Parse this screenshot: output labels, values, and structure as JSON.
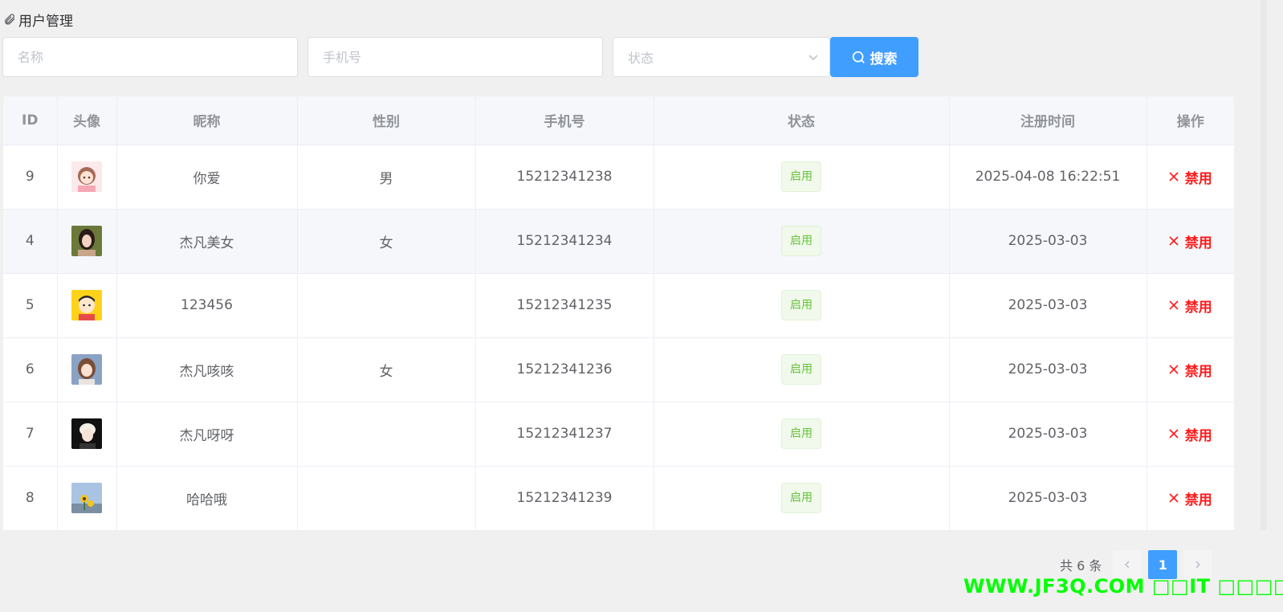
{
  "header": {
    "title": "用户管理",
    "icon": "paperclip-icon"
  },
  "search": {
    "name_placeholder": "名称",
    "phone_placeholder": "手机号",
    "status_placeholder": "状态",
    "button_label": "搜索"
  },
  "table": {
    "columns": [
      "ID",
      "头像",
      "昵称",
      "性别",
      "手机号",
      "状态",
      "注册时间",
      "操作"
    ],
    "rows": [
      {
        "id": "9",
        "avatar": "avatar-anime-girl",
        "nickname": "你爱",
        "gender": "男",
        "phone": "15212341238",
        "status": "启用",
        "registered": "2025-04-08 16:22:51",
        "action": "禁用"
      },
      {
        "id": "4",
        "avatar": "avatar-woman-portrait",
        "nickname": "杰凡美女",
        "gender": "女",
        "phone": "15212341234",
        "status": "启用",
        "registered": "2025-03-03",
        "action": "禁用"
      },
      {
        "id": "5",
        "avatar": "avatar-cartoon-boy",
        "nickname": "123456",
        "gender": "",
        "phone": "15212341235",
        "status": "启用",
        "registered": "2025-03-03",
        "action": "禁用"
      },
      {
        "id": "6",
        "avatar": "avatar-girl-portrait",
        "nickname": "杰凡咳咳",
        "gender": "女",
        "phone": "15212341236",
        "status": "启用",
        "registered": "2025-03-03",
        "action": "禁用"
      },
      {
        "id": "7",
        "avatar": "avatar-blond-boy",
        "nickname": "杰凡呀呀",
        "gender": "",
        "phone": "15212341237",
        "status": "启用",
        "registered": "2025-03-03",
        "action": "禁用"
      },
      {
        "id": "8",
        "avatar": "avatar-sunflower",
        "nickname": "哈哈哦",
        "gender": "",
        "phone": "15212341239",
        "status": "启用",
        "registered": "2025-03-03",
        "action": "禁用"
      }
    ]
  },
  "pagination": {
    "total_label": "共 6 条",
    "current_page": "1"
  },
  "watermark": {
    "text": "WWW.JF3Q.COM □□IT □□□□"
  },
  "colors": {
    "primary": "#409eff",
    "success_text": "#67c23a",
    "success_bg": "#f0f9eb",
    "success_border": "#e1f3d8",
    "danger": "#ff1a1a",
    "watermark": "#00ff00"
  }
}
